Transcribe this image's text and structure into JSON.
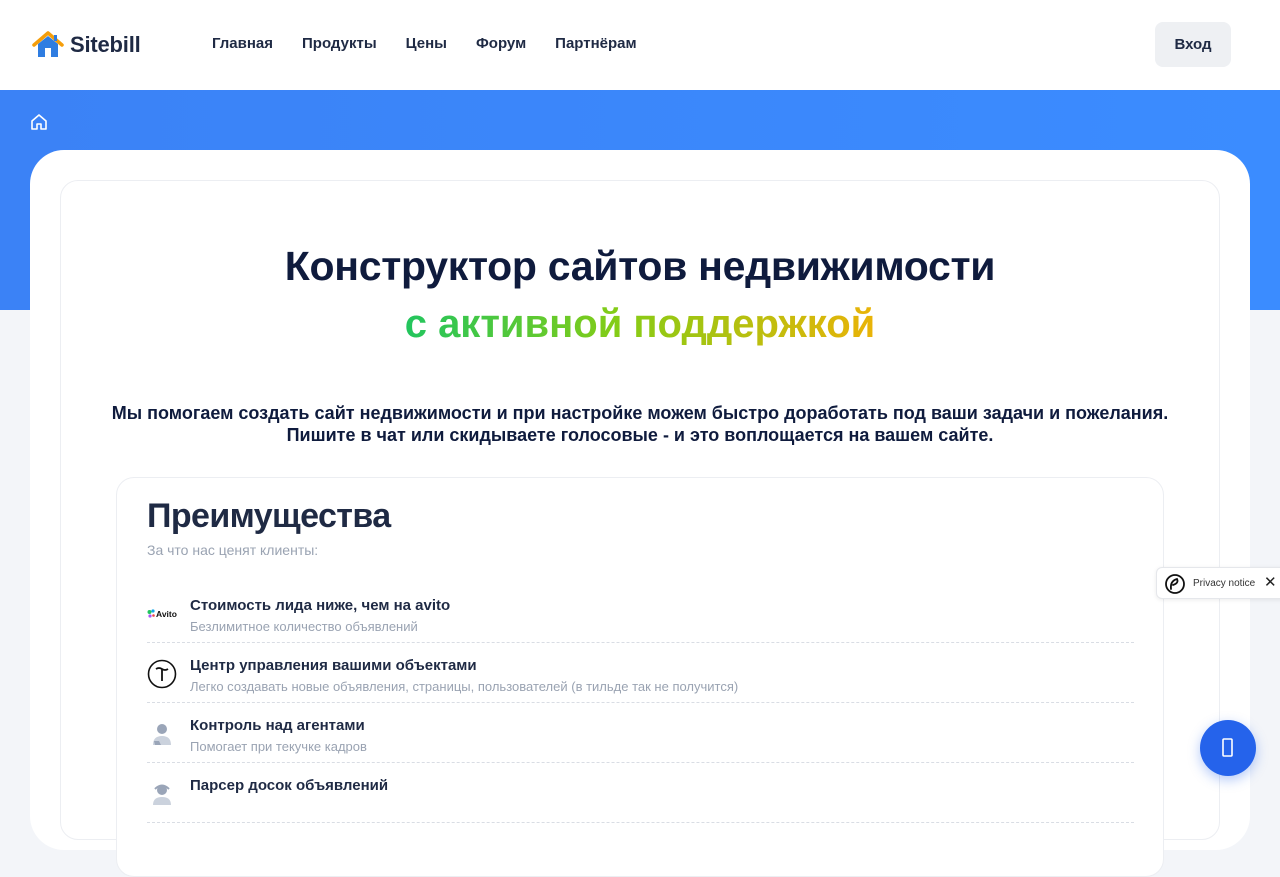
{
  "header": {
    "logo_text": "Sitebill",
    "nav": [
      "Главная",
      "Продукты",
      "Цены",
      "Форум",
      "Партнёрам"
    ],
    "login_label": "Вход"
  },
  "hero": {
    "title": "Конструктор сайтов недвижимости",
    "title_accent": "с активной поддержкой",
    "lead_line1": "Мы помогаем создать сайт недвижимости и при настройке можем быстро доработать под ваши задачи и пожелания.",
    "lead_line2": "Пишите в чат или скидываете голосовые - и это воплощается на вашем сайте."
  },
  "advantages": {
    "title": "Преимущества",
    "subtitle": "За что нас ценят клиенты:",
    "items": [
      {
        "icon": "avito-logo",
        "logo_text": "Avito",
        "title": "Стоимость лида ниже, чем на avito",
        "desc": "Безлимитное количество объявлений"
      },
      {
        "icon": "tilda-icon",
        "title": "Центр управления вашими объектами",
        "desc": "Легко создавать новые объявления, страницы, пользователей (в тильде так не получится)"
      },
      {
        "icon": "agent-icon",
        "title": "Контроль над агентами",
        "desc": "Помогает при текучке кадров"
      },
      {
        "icon": "parser-icon",
        "title": "Парсер досок объявлений",
        "desc": ""
      }
    ]
  },
  "privacy": {
    "label": "Privacy notice",
    "close": "✕"
  },
  "colors": {
    "brand_blue": "#3b82f6",
    "accent_green": "#22c55e",
    "accent_yellow": "#eab308",
    "text_dark": "#1f2a44"
  }
}
